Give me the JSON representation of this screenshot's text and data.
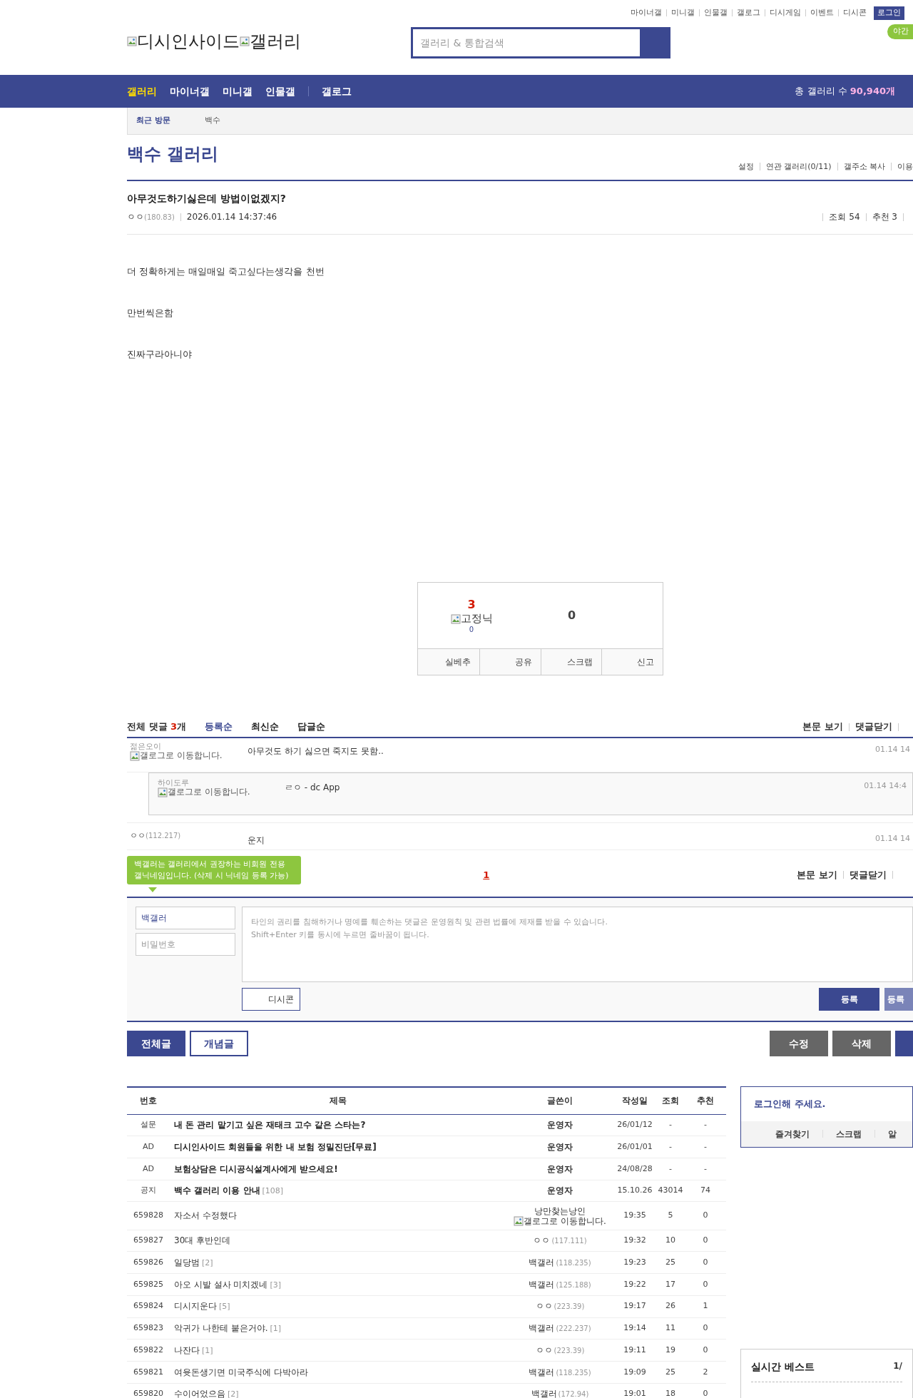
{
  "top_links": [
    "마이너갤",
    "미니갤",
    "인물갤",
    "갤로그",
    "디시게임",
    "이벤트",
    "디시콘"
  ],
  "login_button": "로그인",
  "night_mode": "야간",
  "logo": {
    "site": "디시인사이드",
    "gallery": "갤러리"
  },
  "search": {
    "placeholder": "갤러리 & 통합검색"
  },
  "nav": {
    "items": [
      {
        "label": "갤러리",
        "selected": true
      },
      {
        "label": "마이너갤",
        "selected": false
      },
      {
        "label": "미니갤",
        "selected": false
      },
      {
        "label": "인물갤",
        "selected": false
      },
      {
        "label": "갤로그",
        "selected": false
      }
    ],
    "total_label": "총 갤러리 수",
    "total_value": "90,940개"
  },
  "recent": {
    "label": "최근 방문",
    "items": [
      "백수"
    ]
  },
  "gallery": {
    "title": "백수 갤러리",
    "links": [
      "설정",
      "연관 갤러리(0/11)",
      "갤주소 복사",
      "이용"
    ]
  },
  "post": {
    "title": "아무것도하기싫은데 방법이없겠지?",
    "author": "ㅇㅇ",
    "ip": "(180.83)",
    "date": "2026.01.14 14:37:46",
    "views": "조회 54",
    "recommend": "추천 3",
    "body": [
      "더 정확하게는 매일매일 죽고싶다는생각을 천번",
      "만번씩은함",
      "진짜구라아니야"
    ]
  },
  "vote": {
    "up": "3",
    "fixed_alt": "고정닉",
    "fixed_count": "0",
    "down": "0",
    "buttons": [
      "실베추",
      "공유",
      "스크랩",
      "신고"
    ]
  },
  "comments_header": {
    "label": "전체 댓글",
    "count": "3",
    "unit": "개",
    "sorts": [
      {
        "label": "등록순",
        "selected": true
      },
      {
        "label": "최신순",
        "selected": false
      },
      {
        "label": "답글순",
        "selected": false
      }
    ],
    "links": [
      "본문 보기",
      "댓글닫기"
    ]
  },
  "comments": [
    {
      "kind": "comment",
      "nick": "젊은오이",
      "icon_alt": "갤로그로 이동합니다.",
      "text": "아무것도 하기 싫으면 죽지도 못함..",
      "date": "01.14 14"
    },
    {
      "kind": "reply",
      "nick": "하이도루",
      "icon_alt": "갤로그로 이동합니다.",
      "text": "ㄹㅇ - dc App",
      "date": "01.14 14:4"
    },
    {
      "kind": "comment",
      "nick": "ㅇㅇ",
      "ip": "(112.217)",
      "text": "운지",
      "date": "01.14 14"
    }
  ],
  "pagination": [
    {
      "label": "1",
      "selected": true
    }
  ],
  "bottom_links": [
    "본문 보기",
    "댓글닫기"
  ],
  "tooltip": "백갤러는 갤러리에서 권장하는 비회원 전용 갤닉네임입니다. (삭제 시 닉네임 등록 가능)",
  "comment_form": {
    "nickname": "백갤러",
    "password_placeholder": "비밀번호",
    "placeholder": "타인의 권리를 침해하거나 명예를 훼손하는 댓글은 운영원칙 및 관련 법률에 제재를 받을 수 있습니다.\nShift+Enter 키를 동시에 누르면 줄바꿈이 됩니다.",
    "dccon": "디시콘",
    "submit": "등록",
    "submit2": "등록"
  },
  "list_buttons": [
    {
      "label": "전체글",
      "selected": true
    },
    {
      "label": "개념글",
      "selected": false
    }
  ],
  "post_buttons": [
    "수정",
    "삭제"
  ],
  "table": {
    "columns": [
      "번호",
      "제목",
      "글쓴이",
      "작성일",
      "조회",
      "추천"
    ],
    "rows": [
      {
        "kind": "notice",
        "no": "설문",
        "title": "내 돈 관리 맡기고 싶은 재태크 고수 같은 스타는?",
        "writer": "운영자",
        "date": "26/01/12",
        "views": "-",
        "likes": "-"
      },
      {
        "kind": "notice",
        "no": "AD",
        "title": "디시인사이드 회원들을 위한 내 보험 정밀진단[무료]",
        "writer": "운영자",
        "date": "26/01/01",
        "views": "-",
        "likes": "-"
      },
      {
        "kind": "notice",
        "no": "AD",
        "title": "보험상담은 디시공식설계사에게 받으세요!",
        "writer": "운영자",
        "date": "24/08/28",
        "views": "-",
        "likes": "-"
      },
      {
        "kind": "notice",
        "no": "공지",
        "title": "백수 갤러리 이용 안내",
        "replies": "[108]",
        "writer": "운영자",
        "date": "15.10.26",
        "views": "43014",
        "likes": "74"
      },
      {
        "kind": "normal",
        "no": "659828",
        "title": "자소서 수정했다",
        "writer": "낭만찾는낭인",
        "writer_icon_alt": "갤로그로 이동합니다.",
        "date": "19:35",
        "views": "5",
        "likes": "0"
      },
      {
        "kind": "normal",
        "no": "659827",
        "title": "30대 후반인데",
        "writer": "ㅇㅇ",
        "ip": "(117.111)",
        "date": "19:32",
        "views": "10",
        "likes": "0"
      },
      {
        "kind": "normal",
        "no": "659826",
        "title": "일당범",
        "replies": "[2]",
        "writer": "백갤러",
        "ip": "(118.235)",
        "date": "19:23",
        "views": "25",
        "likes": "0"
      },
      {
        "kind": "normal",
        "no": "659825",
        "title": "아오 시발 설사 미치겠네",
        "replies": "[3]",
        "writer": "백갤러",
        "ip": "(125.188)",
        "date": "19:22",
        "views": "17",
        "likes": "0"
      },
      {
        "kind": "normal",
        "no": "659824",
        "title": "디시지운다",
        "replies": "[5]",
        "writer": "ㅇㅇ",
        "ip": "(223.39)",
        "date": "19:17",
        "views": "26",
        "likes": "1"
      },
      {
        "kind": "normal",
        "no": "659823",
        "title": "악귀가 나한테 붙은거야.",
        "replies": "[1]",
        "writer": "백갤러",
        "ip": "(222.237)",
        "date": "19:14",
        "views": "11",
        "likes": "0"
      },
      {
        "kind": "normal",
        "no": "659822",
        "title": "나잔다",
        "replies": "[1]",
        "writer": "ㅇㅇ",
        "ip": "(223.39)",
        "date": "19:11",
        "views": "19",
        "likes": "0"
      },
      {
        "kind": "normal",
        "no": "659821",
        "title": "여윳돈생기면 미국주식에 다박아라",
        "writer": "백갤러",
        "ip": "(118.235)",
        "date": "19:09",
        "views": "25",
        "likes": "2"
      },
      {
        "kind": "normal",
        "no": "659820",
        "title": "수이어었으음",
        "replies": "[2]",
        "writer": "백갤러",
        "ip": "(172.94)",
        "date": "19:01",
        "views": "18",
        "likes": "0"
      }
    ]
  },
  "sidebar": {
    "login_prompt": "로그인해 주세요.",
    "links": [
      "즐겨찾기",
      "스크랩",
      "알"
    ],
    "best_title": "실시간 베스트",
    "best_page": "1/"
  }
}
